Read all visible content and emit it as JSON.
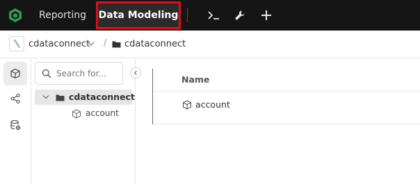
{
  "topbar": {
    "tabs": [
      {
        "label": "Reporting",
        "active": false
      },
      {
        "label": "Data Modeling",
        "active": true
      }
    ],
    "icons": [
      "logo-hexagon-icon",
      "terminal-icon",
      "wrench-icon",
      "plus-icon"
    ],
    "highlight_color": "#e20d17",
    "background": "#151515"
  },
  "breadcrumb": {
    "connection_label": "cdataconnect",
    "separator": "/",
    "folder_label": "cdataconnect"
  },
  "tree": {
    "search_placeholder": "Search for...",
    "folder_label": "cdataconnect",
    "child_label": "account"
  },
  "table": {
    "header_name": "Name",
    "rows": [
      {
        "name": "account"
      }
    ]
  }
}
